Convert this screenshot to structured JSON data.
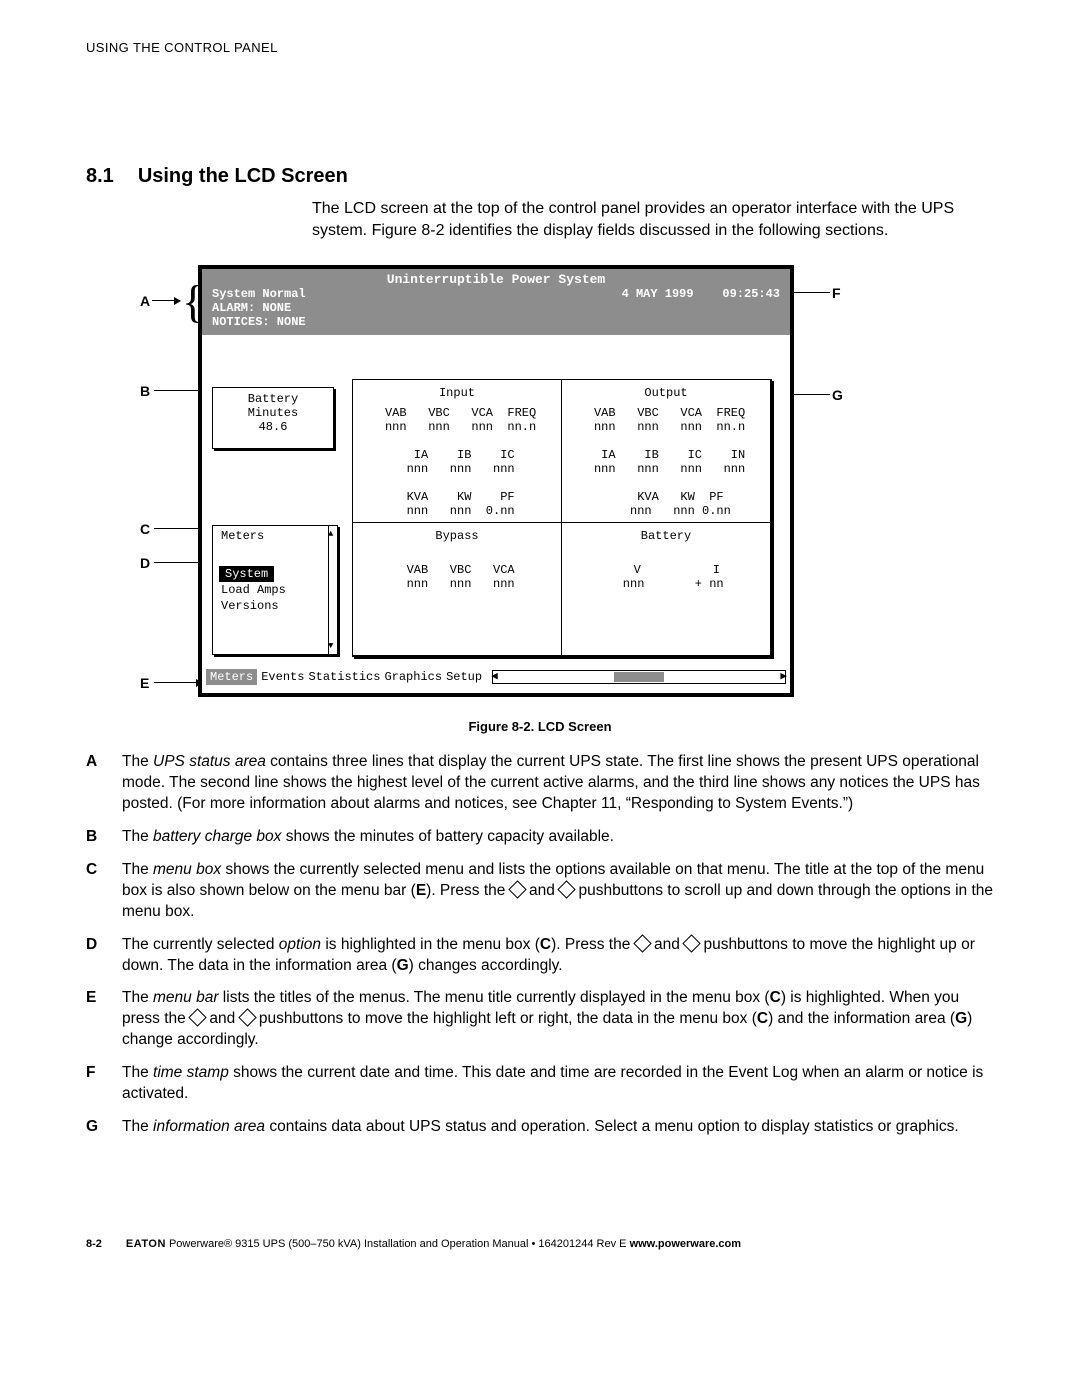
{
  "running_head": "USING THE CONTROL PANEL",
  "section": {
    "num": "8.1",
    "title": "Using the LCD Screen"
  },
  "intro": "The LCD screen at the top of the control panel provides an operator interface with the UPS system. Figure 8-2 identifies the display fields discussed in the following sections.",
  "lcd": {
    "title": "Uninterruptible Power System",
    "status": [
      "System Normal",
      "ALARM:  NONE",
      "NOTICES: NONE"
    ],
    "date": "4 MAY 1999",
    "time": "09:25:43",
    "battery": {
      "l1": "Battery",
      "l2": "Minutes",
      "l3": "48.6"
    },
    "menu": {
      "title": "Meters",
      "selected": "System",
      "items": [
        "Load Amps",
        "Versions"
      ]
    },
    "cells": {
      "input": {
        "h": "Input",
        "rows": " VAB   VBC   VCA  FREQ\n nnn   nnn   nnn  nn.n\n\n  IA    IB    IC\n nnn   nnn   nnn\n\n KVA    KW    PF\n nnn   nnn  0.nn"
      },
      "output": {
        "h": "Output",
        "rows": " VAB   VBC   VCA  FREQ\n nnn   nnn   nnn  nn.n\n\n  IA    IB    IC    IN\n nnn   nnn   nnn   nnn\n\n    KVA   KW  PF\n    nnn   nnn 0.nn"
      },
      "bypass": {
        "h": "Bypass",
        "rows": "\n VAB   VBC   VCA\n nnn   nnn   nnn"
      },
      "battery": {
        "h": "Battery",
        "rows": "\n   V          I\n  nnn       + nn"
      }
    },
    "menubar": {
      "selected": "Meters",
      "items": [
        "Events",
        "Statistics",
        "Graphics",
        "Setup"
      ]
    }
  },
  "caption": "Figure 8-2. LCD Screen",
  "callouts": {
    "A": "A",
    "B": "B",
    "C": "C",
    "D": "D",
    "E": "E",
    "F": "F",
    "G": "G"
  },
  "defs": {
    "A": {
      "em": "UPS status area",
      "pre": "The ",
      "post": " contains three lines that display the current UPS state. The first line shows the present UPS operational mode. The second line shows the highest level of the current active alarms, and the third line shows any notices the UPS has posted. (For more information about alarms and notices, see Chapter 11, “Responding to System Events.”)"
    },
    "B": {
      "em": "battery charge box",
      "pre": "The ",
      "post": " shows the minutes of battery capacity available."
    },
    "C": {
      "em": "menu box",
      "pre": "The ",
      "post1": " shows the currently selected menu and lists the options available on that menu. The title at the top of the menu box is also shown below on the menu bar (",
      "boldE": "E",
      "post2": "). Press the ",
      "post3": " and ",
      "post4": " pushbuttons to scroll up and down through the options in the menu box."
    },
    "D": {
      "em": "option",
      "pre": "The currently selected ",
      "post1": " is highlighted in the menu box (",
      "boldC": "C",
      "post2": "). Press the ",
      "post3": " and ",
      "post4": " pushbuttons to move the highlight up or down. The data in the information area (",
      "boldG": "G",
      "post5": ") changes accordingly."
    },
    "E": {
      "em": "menu bar",
      "pre": "The ",
      "post1": " lists the titles of the menus. The menu title currently displayed in the menu box (",
      "boldC": "C",
      "post2": ") is highlighted. When you press the ",
      "post3": " and ",
      "post4": " pushbuttons to move the highlight left or right, the data in the menu box (",
      "boldC2": "C",
      "post5": ") and the information area (",
      "boldG": "G",
      "post6": ") change accordingly."
    },
    "F": {
      "em": "time stamp",
      "pre": "The ",
      "post": " shows the current date and time. This date and time are recorded in the Event Log when an alarm or notice is activated."
    },
    "G": {
      "em": "information area",
      "pre": "The ",
      "post": " contains data about UPS status and operation. Select a menu option to display statistics or graphics."
    }
  },
  "footer": {
    "page": "8-2",
    "brand": "EATON",
    "text": " Powerware® 9315 UPS (500–750 kVA) Installation and Operation Manual  •  164201244 Rev E ",
    "url": "www.powerware.com"
  }
}
